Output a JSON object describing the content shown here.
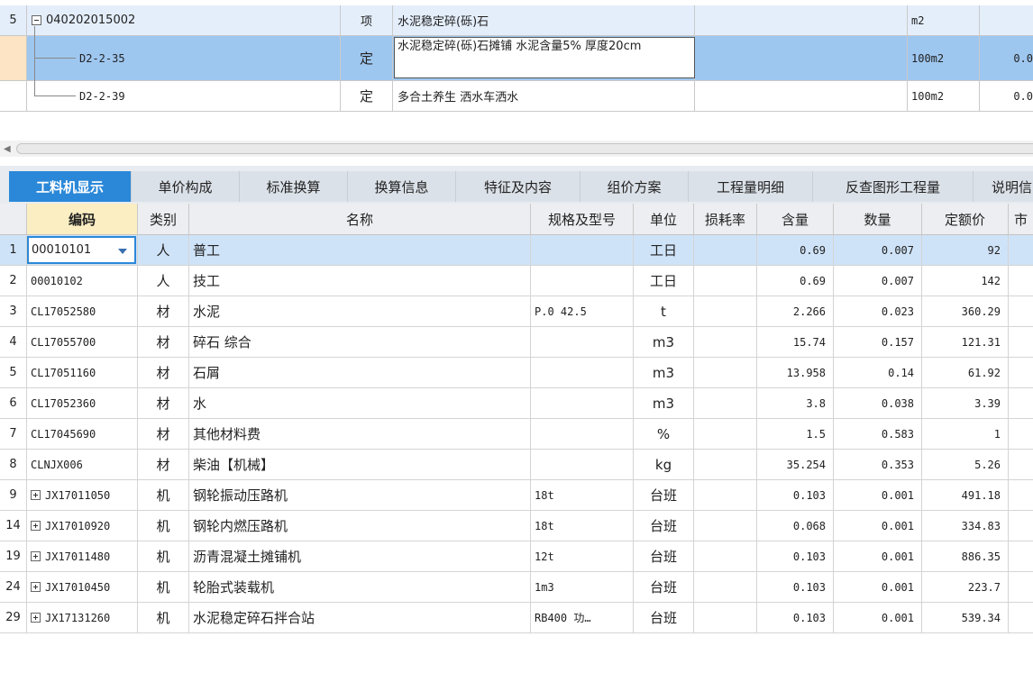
{
  "top_rows": [
    {
      "num": "5",
      "code": "040202015002",
      "type": "项",
      "name": "水泥稳定碎(砾)石",
      "unit": "m2",
      "qty": ""
    },
    {
      "num": "",
      "code": "D2-2-35",
      "type": "定",
      "name": "水泥稳定碎(砾)石摊铺 水泥含量5% 厚度20cm",
      "unit": "100m2",
      "qty": "0.0"
    },
    {
      "num": "",
      "code": "D2-2-39",
      "type": "定",
      "name": "多合土养生 洒水车洒水",
      "unit": "100m2",
      "qty": "0.0"
    }
  ],
  "tabs": [
    "工料机显示",
    "单价构成",
    "标准换算",
    "换算信息",
    "特征及内容",
    "组价方案",
    "工程量明细",
    "反查图形工程量",
    "说明信"
  ],
  "headers": {
    "code": "编码",
    "type": "类别",
    "name": "名称",
    "spec": "规格及型号",
    "unit": "单位",
    "loss": "损耗率",
    "content": "含量",
    "qty": "数量",
    "price": "定额价",
    "more": "市"
  },
  "rows": [
    {
      "num": "1",
      "code": "00010101",
      "type": "人",
      "name": "普工",
      "spec": "",
      "unit": "工日",
      "content": "0.69",
      "qty": "0.007",
      "price": "92",
      "expand": false
    },
    {
      "num": "2",
      "code": "00010102",
      "type": "人",
      "name": "技工",
      "spec": "",
      "unit": "工日",
      "content": "0.69",
      "qty": "0.007",
      "price": "142",
      "expand": false
    },
    {
      "num": "3",
      "code": "CL17052580",
      "type": "材",
      "name": "水泥",
      "spec": "P.0 42.5",
      "unit": "t",
      "content": "2.266",
      "qty": "0.023",
      "price": "360.29",
      "expand": false
    },
    {
      "num": "4",
      "code": "CL17055700",
      "type": "材",
      "name": "碎石 综合",
      "spec": "",
      "unit": "m3",
      "content": "15.74",
      "qty": "0.157",
      "price": "121.31",
      "expand": false
    },
    {
      "num": "5",
      "code": "CL17051160",
      "type": "材",
      "name": "石屑",
      "spec": "",
      "unit": "m3",
      "content": "13.958",
      "qty": "0.14",
      "price": "61.92",
      "expand": false
    },
    {
      "num": "6",
      "code": "CL17052360",
      "type": "材",
      "name": "水",
      "spec": "",
      "unit": "m3",
      "content": "3.8",
      "qty": "0.038",
      "price": "3.39",
      "expand": false
    },
    {
      "num": "7",
      "code": "CL17045690",
      "type": "材",
      "name": "其他材料费",
      "spec": "",
      "unit": "%",
      "content": "1.5",
      "qty": "0.583",
      "price": "1",
      "expand": false
    },
    {
      "num": "8",
      "code": "CLNJX006",
      "type": "材",
      "name": "柴油【机械】",
      "spec": "",
      "unit": "kg",
      "content": "35.254",
      "qty": "0.353",
      "price": "5.26",
      "expand": false
    },
    {
      "num": "9",
      "code": "JX17011050",
      "type": "机",
      "name": "钢轮振动压路机",
      "spec": "18t",
      "unit": "台班",
      "content": "0.103",
      "qty": "0.001",
      "price": "491.18",
      "expand": true
    },
    {
      "num": "14",
      "code": "JX17010920",
      "type": "机",
      "name": "钢轮内燃压路机",
      "spec": "18t",
      "unit": "台班",
      "content": "0.068",
      "qty": "0.001",
      "price": "334.83",
      "expand": true
    },
    {
      "num": "19",
      "code": "JX17011480",
      "type": "机",
      "name": "沥青混凝土摊铺机",
      "spec": "12t",
      "unit": "台班",
      "content": "0.103",
      "qty": "0.001",
      "price": "886.35",
      "expand": true
    },
    {
      "num": "24",
      "code": "JX17010450",
      "type": "机",
      "name": "轮胎式装载机",
      "spec": "1m3",
      "unit": "台班",
      "content": "0.103",
      "qty": "0.001",
      "price": "223.7",
      "expand": true
    },
    {
      "num": "29",
      "code": "JX17131260",
      "type": "机",
      "name": "水泥稳定碎石拌合站",
      "spec": "RB400 功…",
      "unit": "台班",
      "content": "0.103",
      "qty": "0.001",
      "price": "539.34",
      "expand": true
    }
  ]
}
